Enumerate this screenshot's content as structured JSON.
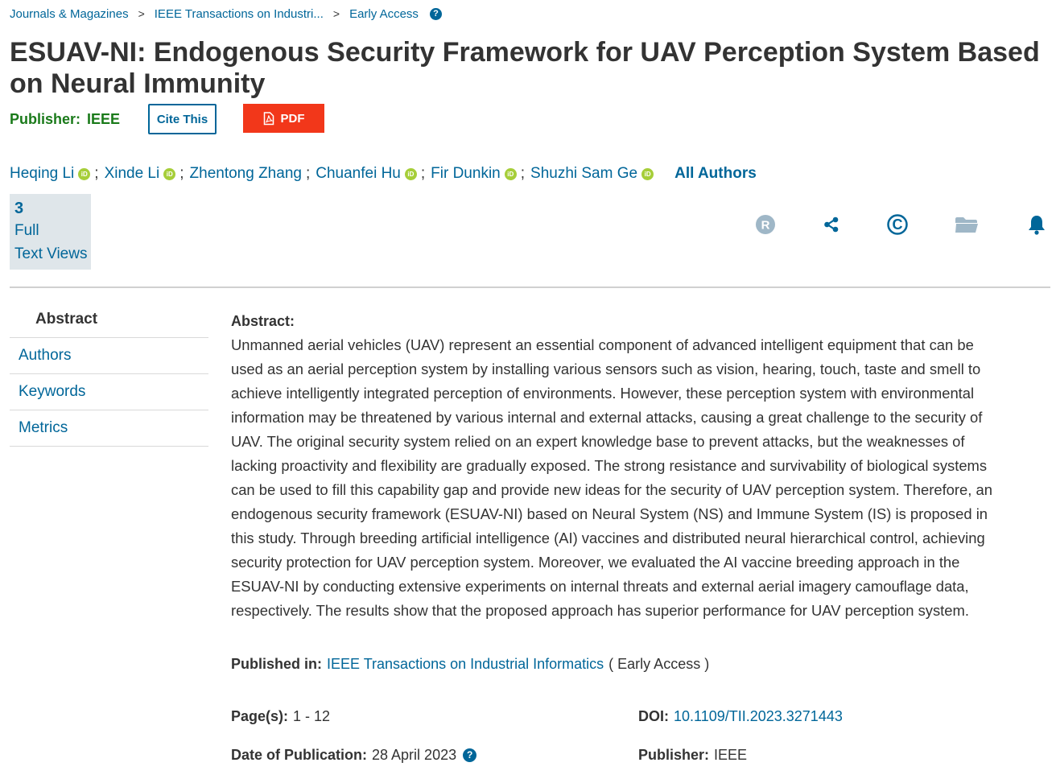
{
  "breadcrumb": {
    "items": [
      "Journals & Magazines",
      "IEEE Transactions on Industri...",
      "Early Access"
    ],
    "separator": ">"
  },
  "article": {
    "title": "ESUAV-NI: Endogenous Security Framework for UAV Perception System Based on Neural Immunity",
    "publisher_label": "Publisher:",
    "publisher": "IEEE",
    "cite_label": "Cite This",
    "pdf_label": "PDF"
  },
  "authors": {
    "list": [
      {
        "name": "Heqing Li",
        "orcid": true
      },
      {
        "name": "Xinde Li",
        "orcid": true
      },
      {
        "name": "Zhentong Zhang",
        "orcid": false
      },
      {
        "name": "Chuanfei Hu",
        "orcid": true
      },
      {
        "name": "Fir Dunkin",
        "orcid": true
      },
      {
        "name": "Shuzhi Sam Ge",
        "orcid": true
      }
    ],
    "separator": ";",
    "orcid_glyph": "iD",
    "all_authors_label": "All Authors"
  },
  "metrics": {
    "count": "3",
    "line1": "Full",
    "line2": "Text Views"
  },
  "actions": {
    "icons": [
      "rights-r-icon",
      "share-icon",
      "copyright-icon",
      "folder-icon",
      "bell-icon"
    ],
    "r_glyph": "R",
    "copyright_glyph": "©"
  },
  "sidebar": {
    "items": [
      {
        "label": "Abstract",
        "active": true
      },
      {
        "label": "Authors",
        "active": false
      },
      {
        "label": "Keywords",
        "active": false
      },
      {
        "label": "Metrics",
        "active": false
      }
    ]
  },
  "abstract": {
    "heading": "Abstract:",
    "lines": [
      "Unmanned aerial vehicles (UAV) represent an essential component of advanced intelligent equipment that can be",
      "used as an aerial perception system by installing various sensors such as vision, hearing, touch, taste and smell to",
      "achieve intelligently integrated perception of environments. However, these perception system with environmental",
      "information may be threatened by various internal and external attacks, causing a great challenge to the security of",
      "UAV. The original security system relied on an expert knowledge base to prevent attacks, but the weaknesses of",
      "lacking proactivity and flexibility are gradually exposed. The strong resistance and survivability of biological systems",
      "can be used to fill this capability gap and provide new ideas for the security of UAV perception system. Therefore, an",
      "endogenous security framework (ESUAV-NI) based on Neural System (NS) and Immune System (IS) is proposed in",
      "this study. Through breeding artificial intelligence (AI) vaccines and distributed neural hierarchical control, achieving",
      "security protection for UAV perception system. Moreover, we evaluated the AI vaccine breeding approach in the",
      "ESUAV-NI by conducting extensive experiments on internal threats and external aerial imagery camouflage data,",
      "respectively. The results show that the proposed approach has superior performance for UAV perception system."
    ]
  },
  "details": {
    "published_in_label": "Published in:",
    "published_in_link": "IEEE Transactions on Industrial Informatics",
    "published_in_suffix": "( Early Access )",
    "pages_label": "Page(s):",
    "pages": "1 - 12",
    "doi_label": "DOI:",
    "doi": "10.1109/TII.2023.3271443",
    "date_label": "Date of Publication:",
    "date": "28 April 2023",
    "publisher_label": "Publisher:",
    "publisher": "IEEE"
  },
  "colors": {
    "link": "#006699",
    "publisher_green": "#1a7a1a",
    "pdf_red": "#f2371a",
    "orcid_green": "#a6ce39",
    "metric_bg": "#dfe6ea",
    "icon_gray": "#9fb7c7"
  }
}
